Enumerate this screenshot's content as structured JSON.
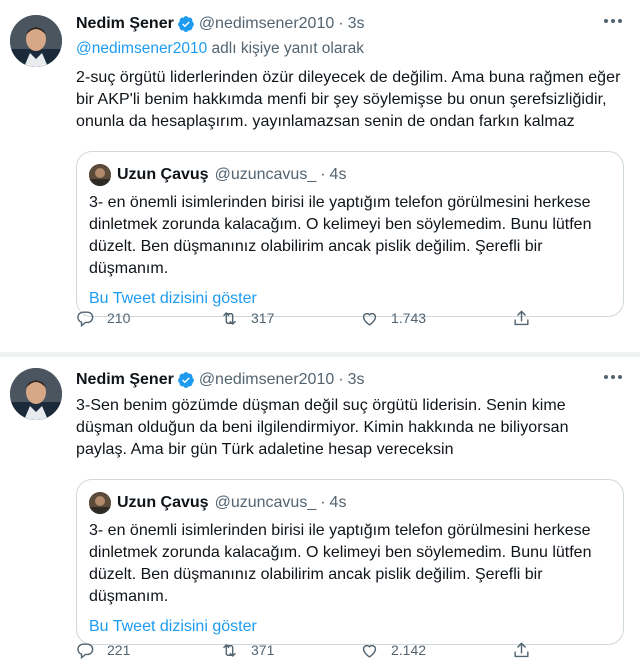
{
  "tweets": [
    {
      "author_name": "Nedim Şener",
      "author_handle": "@nedimsener2010",
      "time": "3s",
      "reply_to_handle": "@nedimsener2010",
      "reply_suffix": "adlı kişiye yanıt olarak",
      "text": "2-suç örgütü liderlerinden özür dileyecek de değilim. Ama buna rağmen eğer bir AKP'li benim hakkımda menfi bir şey söylemişse bu onun şerefsizliğidir, onunla da hesaplaşırım. yayınlamazsan senin de ondan farkın kalmaz",
      "quote": {
        "author_name": "Uzun Çavuş",
        "author_handle": "@uzuncavus_",
        "time": "4s",
        "text": "3- en önemli isimlerinden birisi ile yaptığım telefon görülmesini herkese dinletmek zorunda kalacağım. O kelimeyi ben söylemedim. Bunu  lütfen düzelt. Ben düşmanınız olabilirim ancak pislik değilim. Şerefli bir düşmanım.",
        "thread_link": "Bu Tweet dizisini göster"
      },
      "stats": {
        "replies": "210",
        "retweets": "317",
        "likes": "1.743"
      }
    },
    {
      "author_name": "Nedim Şener",
      "author_handle": "@nedimsener2010",
      "time": "3s",
      "text": "3-Sen benim gözümde düşman değil suç örgütü liderisin. Senin kime düşman olduğun da beni ilgilendirmiyor. Kimin hakkında ne biliyorsan paylaş. Ama bir gün Türk adaletine hesap vereceksin",
      "quote": {
        "author_name": "Uzun Çavuş",
        "author_handle": "@uzuncavus_",
        "time": "4s",
        "text": "3- en önemli isimlerinden birisi ile yaptığım telefon görülmesini herkese dinletmek zorunda kalacağım. O kelimeyi ben söylemedim. Bunu  lütfen düzelt. Ben düşmanınız olabilirim ancak pislik değilim. Şerefli bir düşmanım.",
        "thread_link": "Bu Tweet dizisini göster"
      },
      "stats": {
        "replies": "221",
        "retweets": "371",
        "likes": "2.142"
      }
    }
  ],
  "separator": "·",
  "icons": {
    "verified": "verified-badge-icon",
    "more": "more-options-icon",
    "reply": "reply-icon",
    "retweet": "retweet-icon",
    "like": "like-icon",
    "share": "share-icon"
  },
  "colors": {
    "accent": "#1d9bf0",
    "muted": "#536471",
    "text": "#0f1419",
    "border": "#cfd9de"
  }
}
